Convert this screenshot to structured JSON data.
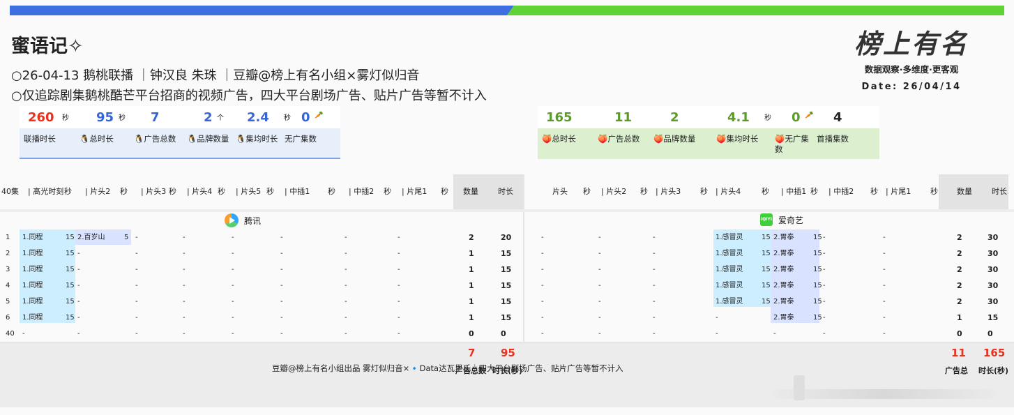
{
  "title": "蜜语记✧",
  "lines": [
    "26-04-13 鹅桃联播 ｜钟汉良 朱珠 ｜豆瓣@榜上有名小组×雾灯似归音",
    "仅追踪剧集鹅桃酷芒平台招商的视频广告，四大平台剧场广告、贴片广告等暂不计入"
  ],
  "logo": {
    "text": "榜上有名",
    "subtitle": "数据观察·多维度·更客观",
    "date": "Date: 26/04/14"
  },
  "left_stats": [
    {
      "value": "260",
      "unit": "秒",
      "label": "联播时长",
      "color": "red"
    },
    {
      "value": "95",
      "unit": "秒",
      "label": "🐧总时长",
      "color": "blue"
    },
    {
      "value": "7",
      "unit": "",
      "label": "🐧广告总数",
      "color": "blue"
    },
    {
      "value": "2",
      "unit": "个",
      "label": "🐧品牌数量",
      "color": "blue"
    },
    {
      "value": "2.4",
      "unit": "秒",
      "label": "🐧集均时长",
      "color": "blue"
    },
    {
      "value": "0",
      "unit": "🥕",
      "label": "无广集数",
      "color": "blue"
    }
  ],
  "right_stats": [
    {
      "value": "165",
      "unit": "",
      "label": "🍑总时长",
      "color": "green"
    },
    {
      "value": "11",
      "unit": "",
      "label": "🍑广告总数",
      "color": "green"
    },
    {
      "value": "2",
      "unit": "",
      "label": "🍑品牌数量",
      "color": "green"
    },
    {
      "value": "4.1",
      "unit": "秒",
      "label": "🍑集均时长",
      "color": "green"
    },
    {
      "value": "0",
      "unit": "🥕",
      "label": "🍑无广集数",
      "color": "green"
    },
    {
      "value": "4",
      "unit": "",
      "label": "首播集数",
      "color": "blk"
    }
  ],
  "left_headers": [
    "40集",
    "| 高光时刻",
    "秒",
    "| 片头2",
    "秒",
    "| 片头3",
    "秒",
    "| 片头4",
    "秒",
    "| 片头5",
    "秒",
    "| 中插1",
    "秒",
    "| 中插2",
    "秒",
    "| 片尾1",
    "秒",
    "数量",
    "时长"
  ],
  "right_headers": [
    "片头",
    "秒",
    "| 片头2",
    "秒",
    "| 片头3",
    "秒",
    "| 片头4",
    "秒",
    "| 中插1",
    "秒",
    "| 中插2",
    "秒",
    "| 片尾1",
    "秒",
    "数量",
    "时长"
  ],
  "platform_left": "腾讯",
  "platform_right": "爱奇艺",
  "platform_right_icon_text": "iQIYI",
  "left_rows": [
    [
      "1",
      "1.同程",
      "15",
      "2.百岁山",
      "5",
      "-",
      "",
      "-",
      "",
      "-",
      "",
      "-",
      "",
      "-",
      "",
      "-",
      "",
      "2",
      "20"
    ],
    [
      "2",
      "1.同程",
      "15",
      "-",
      "",
      "-",
      "",
      "-",
      "",
      "-",
      "",
      "-",
      "",
      "-",
      "",
      "-",
      "",
      "1",
      "15"
    ],
    [
      "3",
      "1.同程",
      "15",
      "-",
      "",
      "-",
      "",
      "-",
      "",
      "-",
      "",
      "-",
      "",
      "-",
      "",
      "-",
      "",
      "1",
      "15"
    ],
    [
      "4",
      "1.同程",
      "15",
      "-",
      "",
      "-",
      "",
      "-",
      "",
      "-",
      "",
      "-",
      "",
      "-",
      "",
      "-",
      "",
      "1",
      "15"
    ],
    [
      "5",
      "1.同程",
      "15",
      "-",
      "",
      "-",
      "",
      "-",
      "",
      "-",
      "",
      "-",
      "",
      "-",
      "",
      "-",
      "",
      "1",
      "15"
    ],
    [
      "6",
      "1.同程",
      "15",
      "-",
      "",
      "-",
      "",
      "-",
      "",
      "-",
      "",
      "-",
      "",
      "-",
      "",
      "-",
      "",
      "1",
      "15"
    ],
    [
      "40",
      "-",
      "",
      "-",
      "",
      "-",
      "",
      "-",
      "",
      "-",
      "",
      "-",
      "",
      "-",
      "",
      "-",
      "",
      "0",
      "0"
    ]
  ],
  "right_rows": [
    [
      "-",
      "",
      "-",
      "",
      "-",
      "",
      "1.感冒灵",
      "15",
      "2.胃泰",
      "15",
      "-",
      "",
      "-",
      "",
      "2",
      "30"
    ],
    [
      "-",
      "",
      "-",
      "",
      "-",
      "",
      "1.感冒灵",
      "15",
      "2.胃泰",
      "15",
      "-",
      "",
      "-",
      "",
      "2",
      "30"
    ],
    [
      "-",
      "",
      "-",
      "",
      "-",
      "",
      "1.感冒灵",
      "15",
      "2.胃泰",
      "15",
      "-",
      "",
      "-",
      "",
      "2",
      "30"
    ],
    [
      "-",
      "",
      "-",
      "",
      "-",
      "",
      "1.感冒灵",
      "15",
      "2.胃泰",
      "15",
      "-",
      "",
      "-",
      "",
      "2",
      "30"
    ],
    [
      "-",
      "",
      "-",
      "",
      "-",
      "",
      "1.感冒灵",
      "15",
      "2.胃泰",
      "15",
      "-",
      "",
      "-",
      "",
      "2",
      "30"
    ],
    [
      "-",
      "",
      "-",
      "",
      "-",
      "",
      "-",
      "",
      "2.胃泰",
      "15",
      "-",
      "",
      "-",
      "",
      "1",
      "15"
    ],
    [
      "-",
      "",
      "-",
      "",
      "-",
      "",
      "-",
      "",
      "-",
      "",
      "-",
      "",
      "-",
      "",
      "0",
      "0"
    ]
  ],
  "footer": {
    "text": "豆瓣@榜上有名小组出品 雾灯似归音×🔹Data达瓦里氏｜四大平台剧场广告、贴片广告等暂不计入",
    "left_total_count": "7",
    "left_total_duration": "95",
    "left_count_label": "广告总数",
    "left_duration_label": "时长(秒)",
    "right_total_count": "11",
    "right_total_duration": "165",
    "right_count_label": "广告总",
    "right_duration_label": "时长(秒)"
  }
}
